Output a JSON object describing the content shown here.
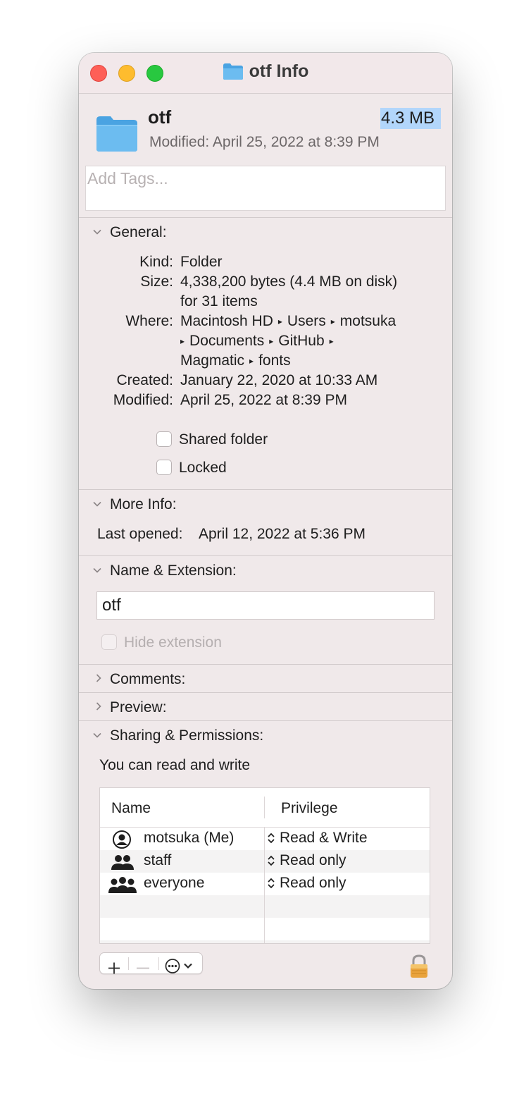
{
  "window": {
    "title": "otf Info"
  },
  "header": {
    "name": "otf",
    "size": "4.3 MB",
    "modified": "Modified: April 25, 2022 at 8:39 PM"
  },
  "tags": {
    "placeholder": "Add Tags..."
  },
  "general": {
    "heading": "General:",
    "rows": [
      {
        "label": "Kind:",
        "value": "Folder"
      },
      {
        "label": "Size:",
        "value": "4,338,200 bytes (4.4 MB on disk)",
        "value2": "for 31 items"
      },
      {
        "label": "Where:",
        "path": [
          "Macintosh HD",
          "Users",
          "motsuka",
          "Documents",
          "GitHub",
          "Magmatic",
          "fonts"
        ]
      },
      {
        "label": "Created:",
        "value": "January 22, 2020 at 10:33 AM"
      },
      {
        "label": "Modified:",
        "value": "April 25, 2022 at 8:39 PM"
      }
    ],
    "shared_folder": "Shared folder",
    "locked": "Locked"
  },
  "more_info": {
    "heading": "More Info:",
    "last_opened_label": "Last opened:",
    "last_opened_value": "April 12, 2022 at 5:36 PM"
  },
  "name_ext": {
    "heading": "Name & Extension:",
    "value": "otf",
    "hide_extension": "Hide extension"
  },
  "comments": {
    "heading": "Comments:"
  },
  "preview": {
    "heading": "Preview:"
  },
  "sharing": {
    "heading": "Sharing & Permissions:",
    "status": "You can read and write",
    "columns": [
      "Name",
      "Privilege"
    ],
    "rows": [
      {
        "name": "motsuka (Me)",
        "privilege": "Read & Write",
        "icon": "user-icon"
      },
      {
        "name": "staff",
        "privilege": "Read only",
        "icon": "group-icon"
      },
      {
        "name": "everyone",
        "privilege": "Read only",
        "icon": "everyone-icon"
      }
    ]
  },
  "colors": {
    "folder": "#5eb3ea",
    "selection": "#b2d6fb",
    "lock": "#e9a33d"
  }
}
